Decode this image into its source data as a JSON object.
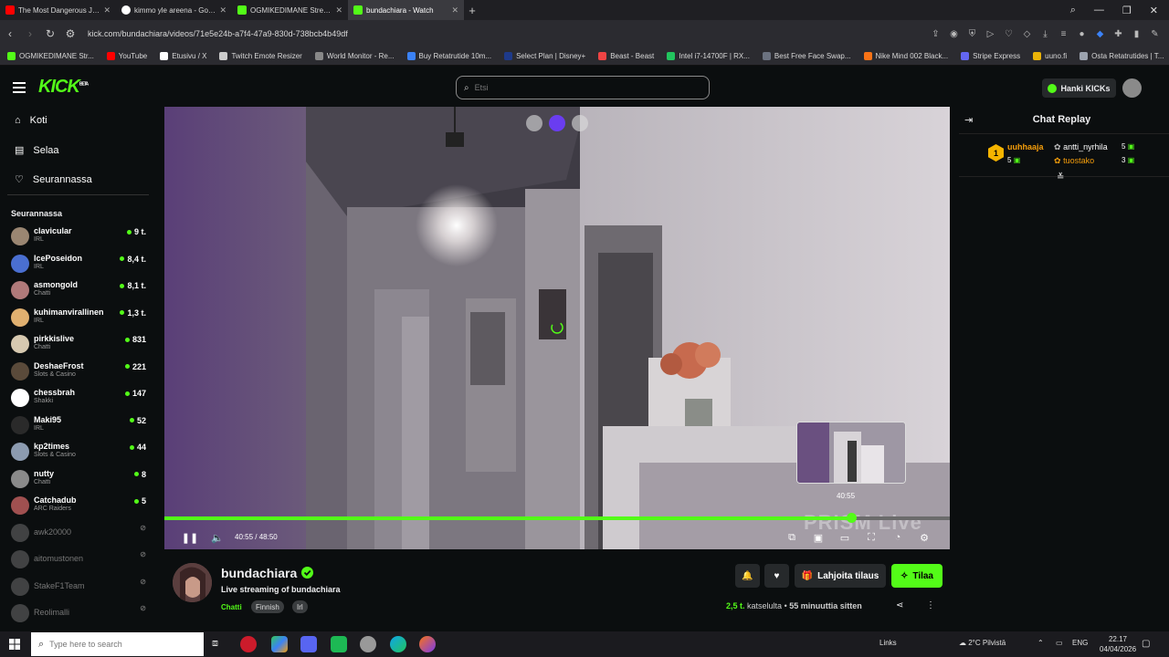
{
  "browser": {
    "tabs": [
      {
        "title": "The Most Dangerous Job",
        "color": "#ff0000"
      },
      {
        "title": "kimmo yle areena - Goog",
        "color": "#ffffff"
      },
      {
        "title": "OGMIKEDIMANE Stream",
        "color": "#53fc18"
      },
      {
        "title": "bundachiara - Watch",
        "color": "#53fc18"
      }
    ],
    "url": "kick.com/bundachiara/videos/71e5e24b-a7f4-47a9-830d-738bcb4b49df",
    "bookmarks": [
      {
        "label": "OGMIKEDIMANE Str...",
        "color": "#53fc18"
      },
      {
        "label": "YouTube",
        "color": "#ff0000"
      },
      {
        "label": "Etusivu / X",
        "color": "#ffffff"
      },
      {
        "label": "Twitch Emote Resizer",
        "color": "#cccccc"
      },
      {
        "label": "World Monitor - Re...",
        "color": "#888888"
      },
      {
        "label": "Buy Retatrutide 10m...",
        "color": "#3b82f6"
      },
      {
        "label": "Select Plan | Disney+",
        "color": "#1e3a8a"
      },
      {
        "label": "Beast - Beast",
        "color": "#ef4444"
      },
      {
        "label": "Intel i7-14700F | RX...",
        "color": "#22c55e"
      },
      {
        "label": "Best Free Face Swap...",
        "color": "#6b7280"
      },
      {
        "label": "Nike Mind 002 Black...",
        "color": "#f97316"
      },
      {
        "label": "Stripe Express",
        "color": "#6366f1"
      },
      {
        "label": "uuno.fi",
        "color": "#eab308"
      },
      {
        "label": "Osta Retatrutides | T...",
        "color": "#9ca3af"
      }
    ]
  },
  "header": {
    "logo": "KICK",
    "logo_badge": "BETA",
    "search_placeholder": "Etsi",
    "get_kicks": "Hanki KICKs"
  },
  "sidebar": {
    "nav": [
      {
        "label": "Koti",
        "icon": "home-icon"
      },
      {
        "label": "Selaa",
        "icon": "browse-icon"
      },
      {
        "label": "Seurannassa",
        "icon": "heart-icon"
      }
    ],
    "following_title": "Seurannassa",
    "following": [
      {
        "name": "clavicular",
        "category": "IRL",
        "viewers": "9 t.",
        "live": true,
        "color": "#9a8672"
      },
      {
        "name": "IcePoseidon",
        "category": "IRL",
        "viewers": "8,4 t.",
        "live": true,
        "color": "#4a6fd1"
      },
      {
        "name": "asmongold",
        "category": "Chatti",
        "viewers": "8,1 t.",
        "live": true,
        "color": "#b07a7a"
      },
      {
        "name": "kuhimanvirallinen",
        "category": "IRL",
        "viewers": "1,3 t.",
        "live": true,
        "color": "#e0b070"
      },
      {
        "name": "pirkkislive",
        "category": "Chatti",
        "viewers": "831",
        "live": true,
        "color": "#d7c9b0"
      },
      {
        "name": "DeshaeFrost",
        "category": "Slots & Casino",
        "viewers": "221",
        "live": true,
        "color": "#5a4a3a"
      },
      {
        "name": "chessbrah",
        "category": "Shakki",
        "viewers": "147",
        "live": true,
        "color": "#ffffff"
      },
      {
        "name": "Maki95",
        "category": "IRL",
        "viewers": "52",
        "live": true,
        "color": "#2a2a2a"
      },
      {
        "name": "kp2times",
        "category": "Slots & Casino",
        "viewers": "44",
        "live": true,
        "color": "#8c9bb0"
      },
      {
        "name": "nutty",
        "category": "Chatti",
        "viewers": "8",
        "live": true,
        "color": "#8a8a8a"
      },
      {
        "name": "Catchadub",
        "category": "ARC Raiders",
        "viewers": "5",
        "live": true,
        "color": "#a05050"
      },
      {
        "name": "awk20000",
        "category": "",
        "viewers": "",
        "live": false,
        "color": "#777777"
      },
      {
        "name": "aitomustonen",
        "category": "",
        "viewers": "",
        "live": false,
        "color": "#777777"
      },
      {
        "name": "StakeF1Team",
        "category": "",
        "viewers": "",
        "live": false,
        "color": "#777777"
      },
      {
        "name": "Reolimalli",
        "category": "",
        "viewers": "",
        "live": false,
        "color": "#777777"
      }
    ]
  },
  "player": {
    "current_time": "40:55",
    "separator": "/",
    "duration": "48:50",
    "progress": 0.873,
    "hover_time": "40:55",
    "watermark": "PRISM Live"
  },
  "stream": {
    "channel": "bundachiara",
    "title": "Live streaming of bundachiara",
    "tags": [
      "Chatti",
      "Finnish",
      "Irl"
    ],
    "gift_label": "Lahjoita tilaus",
    "subscribe_label": "Tilaa",
    "viewers_count": "2,5 t.",
    "viewers_label": "katselulta",
    "bullet": "•",
    "ago": "55 minuuttia sitten"
  },
  "chat": {
    "title": "Chat Replay",
    "leaders": [
      {
        "rank": "1",
        "name": "uuhhaaja",
        "count": "5",
        "color": "#f59e0b"
      },
      {
        "rank": "",
        "name": "antti_nyrhila",
        "count": "5",
        "color": "#ffffff"
      },
      {
        "rank": "",
        "name": "tuostako",
        "count": "3",
        "color": "#f59e0b"
      }
    ]
  },
  "taskbar": {
    "search_placeholder": "Type here to search",
    "links": "Links",
    "weather": "2°C  Pilvistä",
    "lang": "ENG",
    "time": "22.17",
    "date": "04/04/2026"
  },
  "colors": {
    "accent": "#53fc18",
    "background": "#0b0e0f",
    "panel": "#26292b"
  }
}
